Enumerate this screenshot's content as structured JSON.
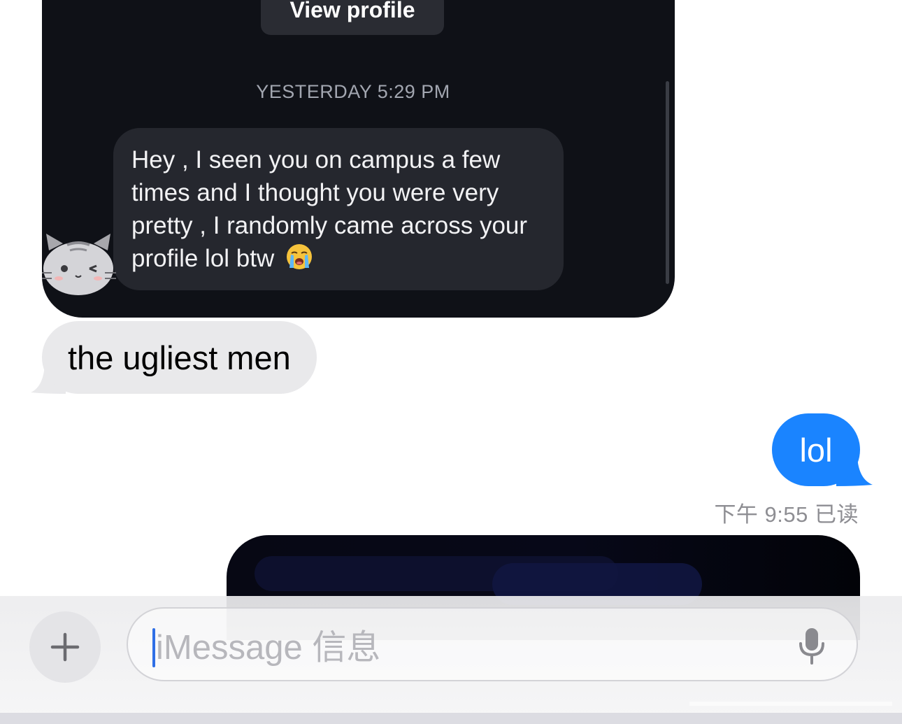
{
  "embedded_screenshot": {
    "view_profile_label": "View profile",
    "timestamp": "YESTERDAY 5:29 PM",
    "message_text": "Hey , I seen you on campus a few times and I thought you were very pretty , I randomly came across your profile lol btw",
    "message_emoji_icon": "loudly-crying-face-icon",
    "avatar_icon": "winking-cat-sticker-icon"
  },
  "conversation": {
    "received_message": "the ugliest men",
    "sent_message": "lol",
    "read_receipt": "下午 9:55 已读"
  },
  "composer": {
    "add_icon": "plus-icon",
    "placeholder": "iMessage 信息",
    "mic_icon": "microphone-icon"
  },
  "colors": {
    "sent_bubble": "#1a84ff",
    "received_bubble": "#e9e9eb",
    "dark_card": "#0f1117",
    "dark_bubble": "#25272e"
  }
}
